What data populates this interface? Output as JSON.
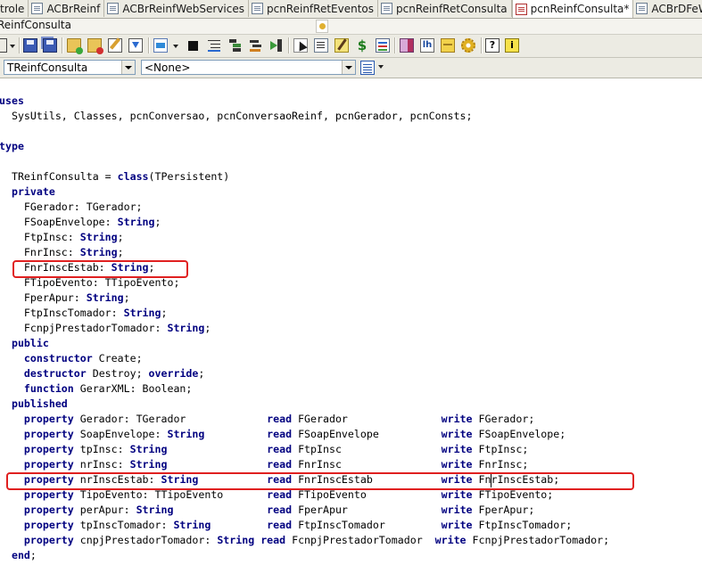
{
  "tabs": [
    {
      "label": "trole",
      "active": false
    },
    {
      "label": "ACBrReinf",
      "active": false
    },
    {
      "label": "ACBrReinfWebServices",
      "active": false
    },
    {
      "label": "pcnReinfRetEventos",
      "active": false
    },
    {
      "label": "pcnReinfRetConsulta",
      "active": false
    },
    {
      "label": "pcnReinfConsulta*",
      "active": true
    },
    {
      "label": "ACBrDFeWebServices",
      "active": false
    }
  ],
  "unit_title": "ReinfConsulta",
  "combos": {
    "class_selector": "TReinfConsulta",
    "member_selector": "<None>"
  },
  "toolbar_icons": [
    "new-item-icon",
    "save-icon",
    "save-all-icon",
    "add-to-project-icon",
    "remove-from-project-icon",
    "edit-icon",
    "download-icon",
    "run-icon",
    "stop-icon",
    "view-lines-icon",
    "tree-icon",
    "tree-collapse-icon",
    "step-into-icon",
    "cursor-icon",
    "page-icon",
    "note-icon",
    "grid-icon",
    "dollar-icon",
    "bulb-icon",
    "colors-icon",
    "header-icon",
    "package-icon",
    "gear-icon",
    "help-icon",
    "info-icon"
  ],
  "code_lines": [
    {
      "tokens": [
        {
          "t": "uses",
          "k": true
        }
      ]
    },
    {
      "tokens": [
        {
          "t": "  SysUtils, Classes, pcnConversao, pcnConversaoReinf, pcnGerador, pcnConsts;",
          "k": false
        }
      ]
    },
    {
      "tokens": []
    },
    {
      "tokens": [
        {
          "t": "type",
          "k": true
        }
      ]
    },
    {
      "tokens": []
    },
    {
      "tokens": [
        {
          "t": "  TReinfConsulta = ",
          "k": false
        },
        {
          "t": "class",
          "k": true
        },
        {
          "t": "(TPersistent)",
          "k": false
        }
      ]
    },
    {
      "tokens": [
        {
          "t": "  ",
          "k": false
        },
        {
          "t": "private",
          "k": true
        }
      ]
    },
    {
      "tokens": [
        {
          "t": "    FGerador: TGerador;",
          "k": false
        }
      ]
    },
    {
      "tokens": [
        {
          "t": "    FSoapEnvelope: ",
          "k": false
        },
        {
          "t": "String",
          "k": true
        },
        {
          "t": ";",
          "k": false
        }
      ]
    },
    {
      "tokens": [
        {
          "t": "    FtpInsc: ",
          "k": false
        },
        {
          "t": "String",
          "k": true
        },
        {
          "t": ";",
          "k": false
        }
      ]
    },
    {
      "tokens": [
        {
          "t": "    FnrInsc: ",
          "k": false
        },
        {
          "t": "String",
          "k": true
        },
        {
          "t": ";",
          "k": false
        }
      ]
    },
    {
      "tokens": [
        {
          "t": "    FnrInscEstab: ",
          "k": false
        },
        {
          "t": "String",
          "k": true
        },
        {
          "t": ";",
          "k": false
        }
      ]
    },
    {
      "tokens": [
        {
          "t": "    FTipoEvento: TTipoEvento;",
          "k": false
        }
      ]
    },
    {
      "tokens": [
        {
          "t": "    FperApur: ",
          "k": false
        },
        {
          "t": "String",
          "k": true
        },
        {
          "t": ";",
          "k": false
        }
      ]
    },
    {
      "tokens": [
        {
          "t": "    FtpInscTomador: ",
          "k": false
        },
        {
          "t": "String",
          "k": true
        },
        {
          "t": ";",
          "k": false
        }
      ]
    },
    {
      "tokens": [
        {
          "t": "    FcnpjPrestadorTomador: ",
          "k": false
        },
        {
          "t": "String",
          "k": true
        },
        {
          "t": ";",
          "k": false
        }
      ]
    },
    {
      "tokens": [
        {
          "t": "  ",
          "k": false
        },
        {
          "t": "public",
          "k": true
        }
      ]
    },
    {
      "tokens": [
        {
          "t": "    ",
          "k": false
        },
        {
          "t": "constructor",
          "k": true
        },
        {
          "t": " Create;",
          "k": false
        }
      ]
    },
    {
      "tokens": [
        {
          "t": "    ",
          "k": false
        },
        {
          "t": "destructor",
          "k": true
        },
        {
          "t": " Destroy; ",
          "k": false
        },
        {
          "t": "override",
          "k": true
        },
        {
          "t": ";",
          "k": false
        }
      ]
    },
    {
      "tokens": [
        {
          "t": "    ",
          "k": false
        },
        {
          "t": "function",
          "k": true
        },
        {
          "t": " GerarXML: Boolean;",
          "k": false
        }
      ]
    },
    {
      "tokens": [
        {
          "t": "  ",
          "k": false
        },
        {
          "t": "published",
          "k": true
        }
      ]
    },
    {
      "tokens": [
        {
          "t": "    ",
          "k": false
        },
        {
          "t": "property",
          "k": true
        },
        {
          "t": " Gerador: TGerador             ",
          "k": false
        },
        {
          "t": "read",
          "k": true
        },
        {
          "t": " FGerador               ",
          "k": false
        },
        {
          "t": "write",
          "k": true
        },
        {
          "t": " FGerador;",
          "k": false
        }
      ]
    },
    {
      "tokens": [
        {
          "t": "    ",
          "k": false
        },
        {
          "t": "property",
          "k": true
        },
        {
          "t": " SoapEnvelope: ",
          "k": false
        },
        {
          "t": "String",
          "k": true
        },
        {
          "t": "          ",
          "k": false
        },
        {
          "t": "read",
          "k": true
        },
        {
          "t": " FSoapEnvelope          ",
          "k": false
        },
        {
          "t": "write",
          "k": true
        },
        {
          "t": " FSoapEnvelope;",
          "k": false
        }
      ]
    },
    {
      "tokens": [
        {
          "t": "    ",
          "k": false
        },
        {
          "t": "property",
          "k": true
        },
        {
          "t": " tpInsc: ",
          "k": false
        },
        {
          "t": "String",
          "k": true
        },
        {
          "t": "                ",
          "k": false
        },
        {
          "t": "read",
          "k": true
        },
        {
          "t": " FtpInsc                ",
          "k": false
        },
        {
          "t": "write",
          "k": true
        },
        {
          "t": " FtpInsc;",
          "k": false
        }
      ]
    },
    {
      "tokens": [
        {
          "t": "    ",
          "k": false
        },
        {
          "t": "property",
          "k": true
        },
        {
          "t": " nrInsc: ",
          "k": false
        },
        {
          "t": "String",
          "k": true
        },
        {
          "t": "                ",
          "k": false
        },
        {
          "t": "read",
          "k": true
        },
        {
          "t": " FnrInsc                ",
          "k": false
        },
        {
          "t": "write",
          "k": true
        },
        {
          "t": " FnrInsc;",
          "k": false
        }
      ]
    },
    {
      "tokens": [
        {
          "t": "    ",
          "k": false
        },
        {
          "t": "property",
          "k": true
        },
        {
          "t": " nrInscEstab: ",
          "k": false
        },
        {
          "t": "String",
          "k": true
        },
        {
          "t": "           ",
          "k": false
        },
        {
          "t": "read",
          "k": true
        },
        {
          "t": " FnrInscEstab           ",
          "k": false
        },
        {
          "t": "write",
          "k": true
        },
        {
          "t": " FnrInscEstab;",
          "k": false
        }
      ]
    },
    {
      "tokens": [
        {
          "t": "    ",
          "k": false
        },
        {
          "t": "property",
          "k": true
        },
        {
          "t": " TipoEvento: TTipoEvento       ",
          "k": false
        },
        {
          "t": "read",
          "k": true
        },
        {
          "t": " FTipoEvento            ",
          "k": false
        },
        {
          "t": "write",
          "k": true
        },
        {
          "t": " FTipoEvento;",
          "k": false
        }
      ]
    },
    {
      "tokens": [
        {
          "t": "    ",
          "k": false
        },
        {
          "t": "property",
          "k": true
        },
        {
          "t": " perApur: ",
          "k": false
        },
        {
          "t": "String",
          "k": true
        },
        {
          "t": "               ",
          "k": false
        },
        {
          "t": "read",
          "k": true
        },
        {
          "t": " FperApur               ",
          "k": false
        },
        {
          "t": "write",
          "k": true
        },
        {
          "t": " FperApur;",
          "k": false
        }
      ]
    },
    {
      "tokens": [
        {
          "t": "    ",
          "k": false
        },
        {
          "t": "property",
          "k": true
        },
        {
          "t": " tpInscTomador: ",
          "k": false
        },
        {
          "t": "String",
          "k": true
        },
        {
          "t": "         ",
          "k": false
        },
        {
          "t": "read",
          "k": true
        },
        {
          "t": " FtpInscTomador         ",
          "k": false
        },
        {
          "t": "write",
          "k": true
        },
        {
          "t": " FtpInscTomador;",
          "k": false
        }
      ]
    },
    {
      "tokens": [
        {
          "t": "    ",
          "k": false
        },
        {
          "t": "property",
          "k": true
        },
        {
          "t": " cnpjPrestadorTomador: ",
          "k": false
        },
        {
          "t": "String",
          "k": true
        },
        {
          "t": " ",
          "k": false
        },
        {
          "t": "read",
          "k": true
        },
        {
          "t": " FcnpjPrestadorTomador  ",
          "k": false
        },
        {
          "t": "write",
          "k": true
        },
        {
          "t": " FcnpjPrestadorTomador;",
          "k": false
        }
      ]
    },
    {
      "tokens": [
        {
          "t": "  ",
          "k": false
        },
        {
          "t": "end",
          "k": true
        },
        {
          "t": ";",
          "k": false
        }
      ]
    }
  ],
  "colors": {
    "keyword": "#000080",
    "highlight_box": "#e02020",
    "chrome": "#ecebe3"
  }
}
